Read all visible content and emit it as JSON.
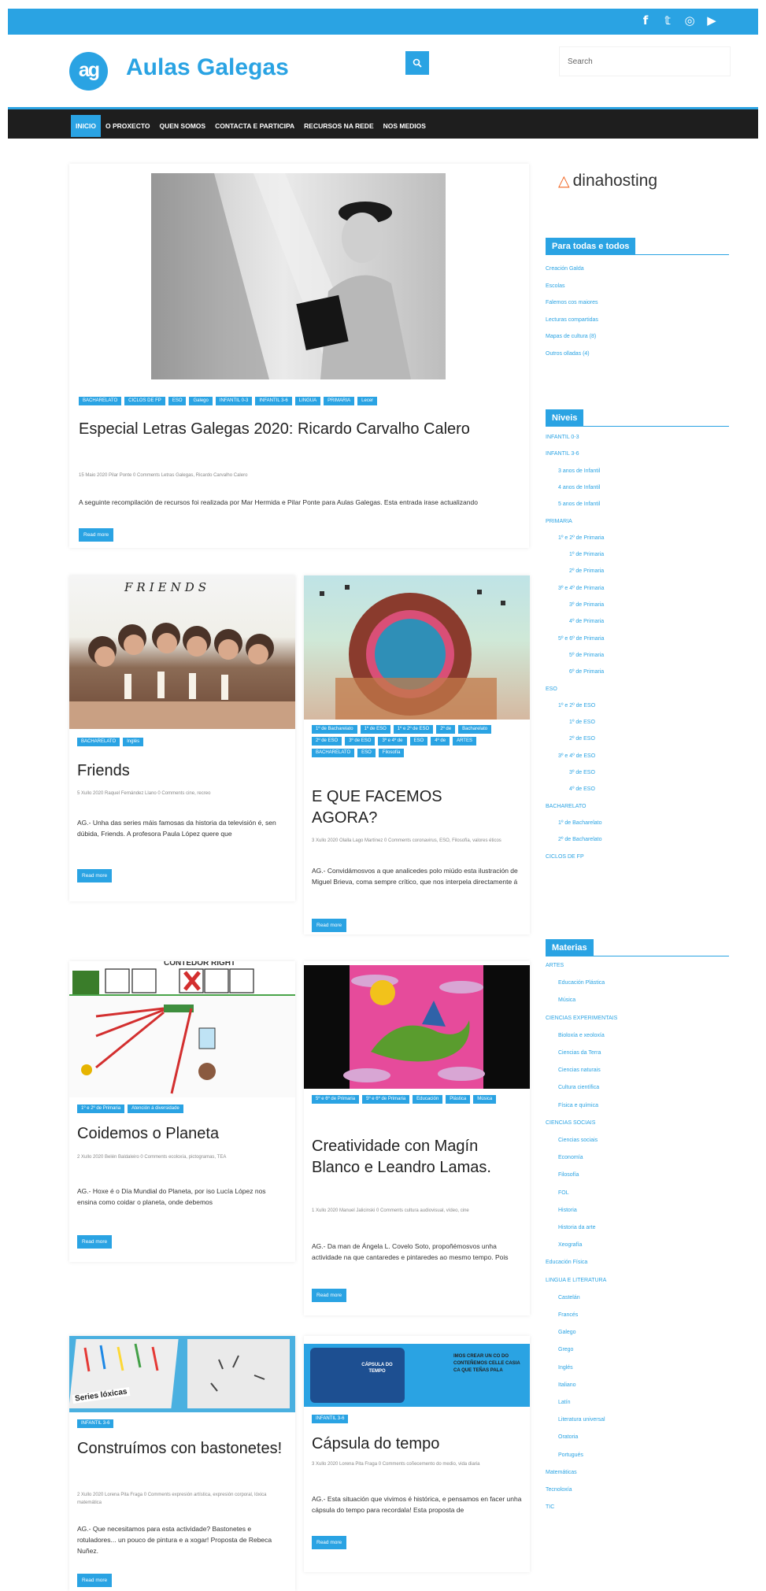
{
  "topbar": {
    "social_icons": [
      "facebook-icon",
      "twitter-icon",
      "instagram-icon",
      "youtube-icon"
    ],
    "glyphs": {
      "facebook": "f",
      "twitter": "𝕥",
      "instagram": "◎",
      "youtube": "▶"
    }
  },
  "header": {
    "logo_text": "ag",
    "site_title": "Aulas Galegas",
    "search_placeholder": "Search"
  },
  "nav": [
    "INICIO",
    "O PROXECTO",
    "QUEN SOMOS",
    "CONTACTA E PARTICIPA",
    "RECURSOS NA REDE",
    "NOS MEDIOS"
  ],
  "featured": {
    "tags": [
      "BACHARELATO",
      "CICLOS DE FP",
      "ESO",
      "Galego",
      "INFANTIL 0-3",
      "INFANTIL 3-6",
      "LINGUA",
      "PRIMARIA",
      "Lecer"
    ],
    "title": "Especial Letras Galegas 2020: Ricardo Carvalho Calero",
    "meta": "15 Maio 2020   Pilar Ponte   0 Comments   Letras Galegas, Ricardo Carvalho Calero",
    "excerpt": "A seguinte recompilación de recursos foi realizada por Mar Hermida e Pilar Ponte para Aulas Galegas. Esta entrada irase actualizando",
    "read_more": "Read more"
  },
  "posts": [
    {
      "image": "FRIENDS",
      "tags": [
        "BACHARELATO",
        "Inglés"
      ],
      "title": "Friends",
      "meta": "5 Xullo 2020   Raquel Fernández Llano   0 Comments   cine, recreo",
      "excerpt": "AG.- Unha das series máis famosas da historia da televisión é, sen dúbida, Friends. A profesora Paula López quere que",
      "read_more": "Read more"
    },
    {
      "image": "",
      "tags": [
        "1º de Bacharelato",
        "1º de ESO",
        "1º e 2º de ESO",
        "2º de",
        "Bacharelato",
        "2º de ESO",
        "3º de ESO",
        "3º e 4º de",
        "ESO",
        "4º de",
        "ARTES",
        "BACHARELATO",
        "ESO",
        "Filosofía"
      ],
      "title": "E QUE FACEMOS AGORA?",
      "meta": "3 Xullo 2020   Olalla Lago Martínez   0 Comments   coronavirus, ESO, Filosofía, valores éticos",
      "excerpt": "AG.- Convidámosvos a que analicedes polo miúdo esta ilustración de Miguel Brieva, coma sempre crítico, que nos interpela directamente á",
      "read_more": "Read more"
    },
    {
      "image": "CONTEDOR RIGHT",
      "tags": [
        "1º e 2º de Primaria",
        "Atención á diversidade"
      ],
      "title": "Coidemos o Planeta",
      "meta": "2 Xullo 2020   Belén Baldaleiro   0 Comments   ecoloxía, pictogramas, TEA",
      "excerpt": "AG.- Hoxe é o Día Mundial do Planeta, por iso Lucía López nos ensina como coidar o planeta, onde debemos",
      "read_more": "Read more"
    },
    {
      "image": "",
      "tags": [
        "5º e 6º de Primaria",
        "5º e 6º de Primaria",
        "Educación",
        "Plástica",
        "Música"
      ],
      "title": "Creatividade con Magín Blanco e Leandro Lamas.",
      "meta": "1 Xullo 2020   Manuel Jalicinski   0 Comments   cultura audiovisual, vídeo, cine",
      "excerpt": "AG.- Da man de Ángela L. Covelo Soto, propoñémosvos unha actividade na que cantaredes e pintaredes ao mesmo tempo. Pois",
      "read_more": "Read more"
    },
    {
      "image": "Series lóxicas",
      "tags": [
        "INFANTIL 3-6"
      ],
      "title": "Construímos con bastonetes!",
      "meta": "2 Xullo 2020   Lorena Pita Fraga   0 Comments   expresión artística, expresión corporal, lóxica matemática",
      "excerpt": "AG.- Que necesitamos para esta actividade? Bastonetes e rotuladores... un pouco de pintura e a xogar! Proposta de Rebeca Nuñez.",
      "read_more": "Read more"
    },
    {
      "image_title": "CÁPSULA DO TEMPO",
      "image_text": "IMOS CREAR UN CO DO CONTEÑEMOS CELLE CASIA CA QUE TEÑAS PALA",
      "tags": [
        "INFANTIL 3-6"
      ],
      "title": "Cápsula do tempo",
      "meta": "3 Xullo 2020   Lorena Pita Fraga   0 Comments   coñecemento do medio, vida diaria",
      "excerpt": "AG.- Esta situación que vivimos é histórica, e pensamos en facer unha cápsula do tempo para recordala! Esta proposta de",
      "read_more": "Read more"
    }
  ],
  "sidebar": {
    "sponsor": "dinahosting",
    "widget1": {
      "title": "Para todas e todos",
      "items": [
        "Creación Galda",
        "Escolas",
        "Falemos cos maiores",
        "Lecturas compartidas",
        "Mapas de cultura (8)",
        "Outros olladas (4)"
      ]
    },
    "widget2": {
      "title": "Niveis",
      "items": [
        "INFANTIL 0-3",
        "INFANTIL 3-6",
        "3 anos de Infantil",
        "4 anos de Infantil",
        "5 anos de Infantil",
        "PRIMARIA",
        "1º e 2º de Primaria",
        "1º de Primaria",
        "2º de Primaria",
        "3º e 4º de Primaria",
        "3º de Primaria",
        "4º de Primaria",
        "5º e 6º de Primaria",
        "5º de Primaria",
        "6º de Primaria",
        "ESO",
        "1º e 2º de ESO",
        "1º de ESO",
        "2º de ESO",
        "3º e 4º de ESO",
        "3º de ESO",
        "4º de ESO",
        "BACHARELATO",
        "1º de Bacharelato",
        "2º de Bacharelato",
        "CICLOS DE FP"
      ]
    },
    "widget3": {
      "title": "Materias",
      "items": [
        "ARTES",
        "Educación Plástica",
        "Música",
        "CIENCIAS EXPERIMENTAIS",
        "Bioloxía e xeoloxía",
        "Ciencias da Terra",
        "Ciencias naturais",
        "Cultura científica",
        "Física e química",
        "CIENCIAS SOCIAIS",
        "Ciencias sociais",
        "Economía",
        "Filosofía",
        "FOL",
        "Historia",
        "Historia da arte",
        "Xeografía",
        "Educación Física",
        "LINGUA E LITERATURA",
        "Castelán",
        "Francés",
        "Galego",
        "Grego",
        "Inglés",
        "Italiano",
        "Latín",
        "Literatura universal",
        "Oratoria",
        "Portugués",
        "Matemáticas",
        "Tecnoloxía",
        "TIC"
      ]
    }
  },
  "colors": {
    "accent": "#2aa3e3",
    "nav_bg": "#1e1e1e"
  }
}
